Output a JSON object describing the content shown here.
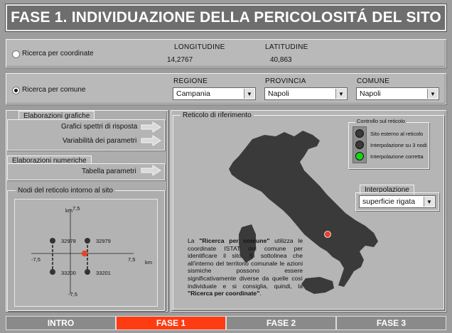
{
  "title": "FASE 1. INDIVIDUAZIONE DELLA PERICOLOSITÁ DEL SITO",
  "coords": {
    "radio_label": "Ricerca per coordinate",
    "longitude_label": "LONGITUDINE",
    "latitude_label": "LATITUDINE",
    "longitude_value": "14,2767",
    "latitude_value": "40,863"
  },
  "comune": {
    "radio_label": "Ricerca per comune",
    "regione_label": "REGIONE",
    "provincia_label": "PROVINCIA",
    "comune_label": "COMUNE",
    "regione_value": "Campania",
    "provincia_value": "Napoli",
    "comune_value": "Napoli"
  },
  "elab_grafiche": {
    "heading": "Elaborazioni grafiche",
    "item1": "Grafici spettri di risposta",
    "item2": "Variabilità dei parametri"
  },
  "elab_numeriche": {
    "heading": "Elaborazioni numeriche",
    "item1": "Tabella parametri"
  },
  "nodi": {
    "heading": "Nodi del reticolo intorno al sito",
    "km_top": "km",
    "val_top": "7,5",
    "val_bottom": "-7,5",
    "val_left": "-7,5",
    "val_right": "7,5",
    "km_right": "km",
    "node_tl": "32978",
    "node_tr": "32979",
    "node_bl": "33200",
    "node_br": "33201"
  },
  "reticolo": {
    "heading": "Reticolo di riferimento",
    "controllo_heading": "Controllo sul reticolo",
    "light1": "Sito esterno al reticolo",
    "light2": "Interpolazione su 3 nodi",
    "light3": "Interpolazione corretta",
    "interp_heading": "Interpolazione",
    "interp_value": "superficie rigata",
    "text_p1": "La ",
    "text_b1": "\"Ricerca per comune\"",
    "text_p2": " utilizza le coordinate ISTAT del comune per identificare il sito.  Si sottolinea che all'interno del territorio comunale le azioni sismiche possono essere significativamente diverse da quelle così individuate e si consiglia, quindi, la ",
    "text_b2": "\"Ricerca per coordinate\"",
    "text_p3": "."
  },
  "tabs": [
    "INTRO",
    "FASE 1",
    "FASE 2",
    "FASE 3"
  ],
  "colors": {
    "active_tab": "#ff3b12",
    "inactive_tab": "#8a8a8a",
    "map_fill": "#3a3a3a",
    "site_dot": "#e8432a",
    "light_green": "#19d419",
    "light_off": "#3a3a3a"
  }
}
